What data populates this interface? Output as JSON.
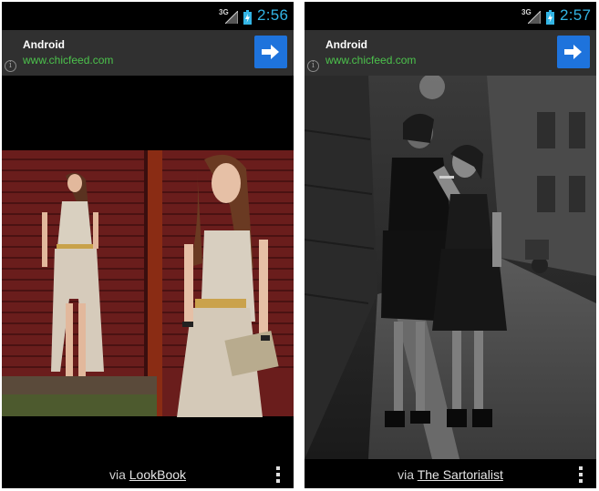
{
  "screens": [
    {
      "status": {
        "network": "3G",
        "time": "2:56"
      },
      "ad": {
        "title": "Android",
        "url": "www.chicfeed.com",
        "info_glyph": "i",
        "button_icon": "arrow-right-icon"
      },
      "photo": {
        "description_icon": "fashion-photo"
      },
      "footer": {
        "via": "via",
        "source": "LookBook"
      }
    },
    {
      "status": {
        "network": "3G",
        "time": "2:57"
      },
      "ad": {
        "title": "Android",
        "url": "www.chicfeed.com",
        "info_glyph": "i",
        "button_icon": "arrow-right-icon"
      },
      "photo": {
        "description_icon": "fashion-photo"
      },
      "footer": {
        "via": "via",
        "source": "The Sartorialist"
      }
    }
  ],
  "colors": {
    "status_time": "#33b5e5",
    "ad_url": "#4cc24c",
    "ad_button": "#1e73dc",
    "ad_background": "#303030"
  }
}
